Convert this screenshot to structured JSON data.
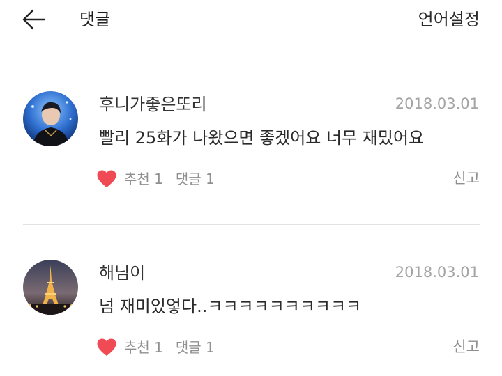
{
  "header": {
    "title": "댓글",
    "lang_setting": "언어설정"
  },
  "colors": {
    "heart": "#f04a55",
    "meta_text": "#8f8f8f",
    "date_text": "#a4a4a4"
  },
  "comments": [
    {
      "username": "후니가좋은또리",
      "date": "2018.03.01",
      "text": "빨리 25화가 나왔으면 좋겠어요 너무 재밌어요",
      "like_label": "추천 1",
      "reply_label": "댓글 1",
      "report_label": "신고",
      "avatar_icon": "profile-photo-person"
    },
    {
      "username": "해님이",
      "date": "2018.03.01",
      "text": "넘 재미있엏다..ㅋㅋㅋㅋㅋㅋㅋㅋㅋㅋ",
      "like_label": "추천 1",
      "reply_label": "댓글 1",
      "report_label": "신고",
      "avatar_icon": "profile-photo-eiffel-tower"
    }
  ]
}
